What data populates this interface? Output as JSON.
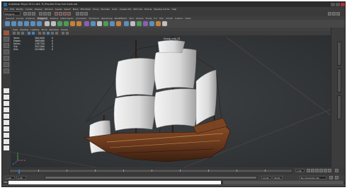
{
  "app": {
    "title": "Autodesk Maya 2014 x64: D:/Pro/tall-Ship-Hull-Sails.mb",
    "menu": [
      "File",
      "Edit",
      "Modify",
      "Create",
      "Display",
      "Window",
      "Assets",
      "Select",
      "Mesh",
      "Edit Mesh",
      "Proxy",
      "Normals",
      "Color",
      "Create UVs",
      "Edit UVs",
      "Muscle",
      "Pipeline Cache",
      "Help"
    ]
  },
  "statusline": {
    "mode": "Polygons"
  },
  "shelf": {
    "tabs": [
      "General",
      "Curves",
      "Surfaces",
      "Polygons",
      "Subdivs",
      "Deformation",
      "Animation",
      "Dynamics",
      "Rendering",
      "PaintEffects",
      "Toon",
      "Muscle",
      "Fluids",
      "Fur",
      "Hair",
      "nCloth",
      "Custom",
      "XGen"
    ],
    "selected": "Polygons"
  },
  "panel": {
    "menu": [
      "View",
      "Shading",
      "Lighting",
      "Show",
      "Renderer",
      "Panels"
    ],
    "camera": "persp",
    "hud": [
      {
        "label": "Verts:",
        "v1": "184100",
        "v2": "0",
        "v3": "0"
      },
      {
        "label": "Edges:",
        "v1": "366548",
        "v2": "0",
        "v3": "0"
      },
      {
        "label": "Faces:",
        "v1": "178772",
        "v2": "0",
        "v3": "0"
      },
      {
        "label": "Tris:",
        "v1": "352126",
        "v2": "0",
        "v3": "0"
      },
      {
        "label": "UVs:",
        "v1": "221580",
        "v2": "0",
        "v3": "0"
      }
    ],
    "scene_label": "Group_ship_01",
    "axis": {
      "x": "x",
      "y": "y",
      "z": "z"
    }
  },
  "timeslider": {
    "start": "1.00",
    "current": "1.00",
    "end": "24.00"
  },
  "rangeslider": {
    "start": "1.00",
    "inner_start": "1.00",
    "inner_end": "24.00",
    "end": "48.00",
    "char_set": "No Character Set"
  },
  "cmdline": {
    "label": "MEL"
  },
  "colors": {
    "maya_bg": "#444444",
    "viewport_bg": "#36393c",
    "sail": "#e6e6e6",
    "hull": "#6b3a1e",
    "selected_tool": "#b84b2b",
    "time_marker": "#2d77c2"
  },
  "icons": [
    "maya-logo-icon",
    "select-tool-icon",
    "lasso-tool-icon",
    "paint-select-icon",
    "move-tool-icon",
    "rotate-tool-icon",
    "scale-tool-icon",
    "play-forward-icon",
    "play-back-icon",
    "step-forward-icon",
    "step-back-icon",
    "go-to-start-icon",
    "go-to-end-icon"
  ]
}
